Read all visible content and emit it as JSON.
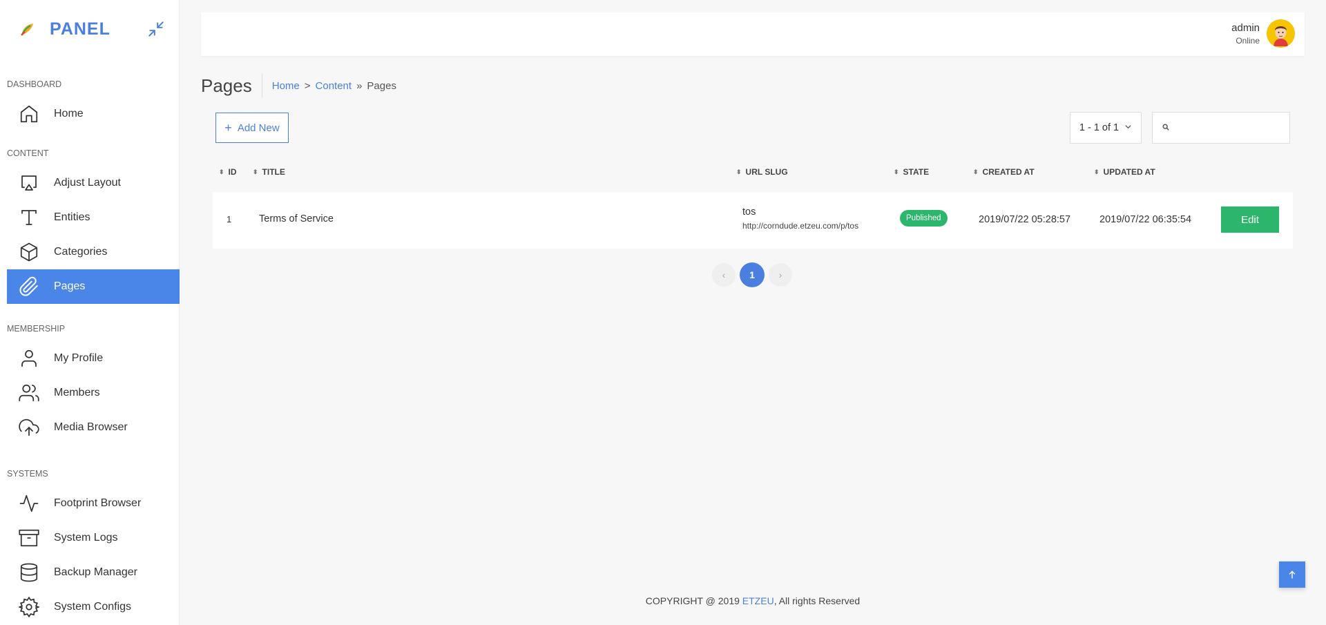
{
  "brand": {
    "name": "PANEL"
  },
  "sidebar": {
    "sections": [
      {
        "title": "DASHBOARD",
        "items": [
          {
            "label": "Home",
            "icon": "home-icon",
            "active": false
          }
        ]
      },
      {
        "title": "CONTENT",
        "items": [
          {
            "label": "Adjust Layout",
            "icon": "monitor-icon",
            "active": false
          },
          {
            "label": "Entities",
            "icon": "type-icon",
            "active": false
          },
          {
            "label": "Categories",
            "icon": "box-icon",
            "active": false
          },
          {
            "label": "Pages",
            "icon": "paperclip-icon",
            "active": true
          }
        ]
      },
      {
        "title": "MEMBERSHIP",
        "items": [
          {
            "label": "My Profile",
            "icon": "user-icon",
            "active": false
          },
          {
            "label": "Members",
            "icon": "users-icon",
            "active": false
          },
          {
            "label": "Media Browser",
            "icon": "upload-cloud-icon",
            "active": false
          }
        ]
      },
      {
        "title": "SYSTEMS",
        "items": [
          {
            "label": "Footprint Browser",
            "icon": "activity-icon",
            "active": false
          },
          {
            "label": "System Logs",
            "icon": "archive-icon",
            "active": false
          },
          {
            "label": "Backup Manager",
            "icon": "database-icon",
            "active": false
          },
          {
            "label": "System Configs",
            "icon": "settings-icon",
            "active": false
          }
        ]
      }
    ]
  },
  "user": {
    "name": "admin",
    "status": "Online"
  },
  "page": {
    "title": "Pages",
    "breadcrumb": {
      "home": "Home",
      "sep1": ">",
      "content": "Content",
      "sep2": "»",
      "current": "Pages"
    }
  },
  "toolbar": {
    "add_label": "Add New",
    "plus": "+",
    "range": "1 - 1 of 1",
    "search_placeholder": ""
  },
  "table": {
    "headers": {
      "id": "ID",
      "title": "TITLE",
      "slug": "URL SLUG",
      "state": "STATE",
      "created": "CREATED AT",
      "updated": "UPDATED AT"
    },
    "rows": [
      {
        "id": "1",
        "title": "Terms of Service",
        "slug": "tos",
        "url": "http://corndude.etzeu.com/p/tos",
        "state": "Published",
        "created": "2019/07/22 05:28:57",
        "updated": "2019/07/22 06:35:54",
        "action": "Edit"
      }
    ]
  },
  "pagination": {
    "prev": "‹",
    "current": "1",
    "next": "›"
  },
  "footer": {
    "prefix": "COPYRIGHT @ 2019 ",
    "brand": "ETZEU",
    "suffix": ", All rights Reserved"
  },
  "colors": {
    "accent": "#4a86e8",
    "success": "#2bb66b"
  }
}
